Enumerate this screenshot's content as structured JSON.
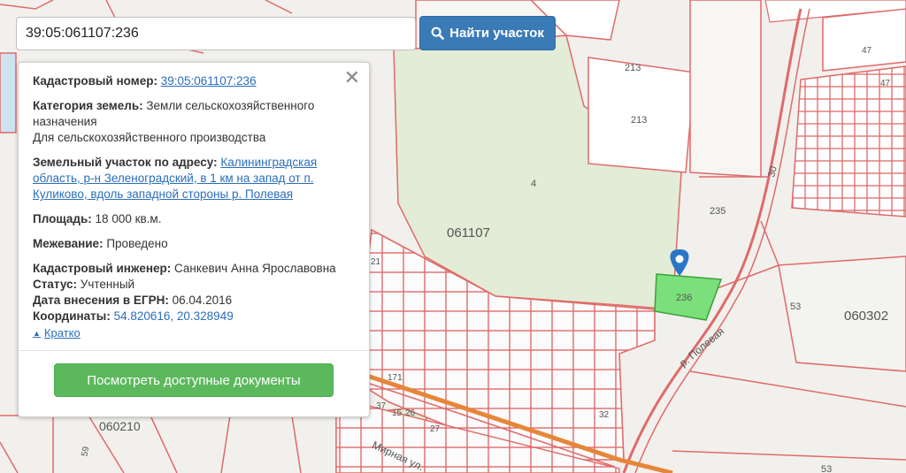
{
  "search": {
    "value": "39:05:061107:236",
    "button_label": "Найти участок",
    "button_icon": "search-icon"
  },
  "info": {
    "cadastral_label": "Кадастровый номер:",
    "cadastral_value": "39:05:061107:236",
    "category_label": "Категория земель:",
    "category_value": "Земли сельскохозяйственного назначения",
    "category_use": "Для сельскохозяйственного производства",
    "address_label": "Земельный участок по адресу:",
    "address_value": "Калининградская область, р-н Зеленоградский, в 1 км на запад от п. Куликово, вдоль западной стороны р. Полевая",
    "area_label": "Площадь:",
    "area_value": "18 000 кв.м.",
    "survey_label": "Межевание:",
    "survey_value": "Проведено",
    "engineer_label": "Кадастровый инженер:",
    "engineer_value": "Санкевич Анна Ярославовна",
    "status_label": "Статус:",
    "status_value": "Учтенный",
    "date_label": "Дата внесения в ЕГРН:",
    "date_value": "06.04.2016",
    "coords_label": "Координаты:",
    "coords_value": "54.820616, 20.328949",
    "brief_label": "Кратко",
    "docs_button_label": "Посмотреть доступные документы"
  },
  "map": {
    "labels": {
      "block_main": "061107",
      "block_east": "060302",
      "block_west": "060210",
      "river": "р. Полевая",
      "street": "Мирная ул.",
      "plot_selected": "236",
      "n213a": "213",
      "n213b": "213",
      "n47a": "47",
      "n47b": "47",
      "n4": "4",
      "n235": "235",
      "n30": "30",
      "n53a": "53",
      "n53b": "53",
      "n21": "21",
      "n171": "171",
      "n37": "37",
      "n15": "15",
      "n26": "26",
      "n27": "27",
      "n32": "32",
      "n59": "59"
    },
    "colors": {
      "parcel_line": "#e06a6a",
      "forest": "#e2ecd4",
      "selected_plot": "#7be07b",
      "pin": "#2a76c6",
      "road": "#e6863a"
    }
  }
}
